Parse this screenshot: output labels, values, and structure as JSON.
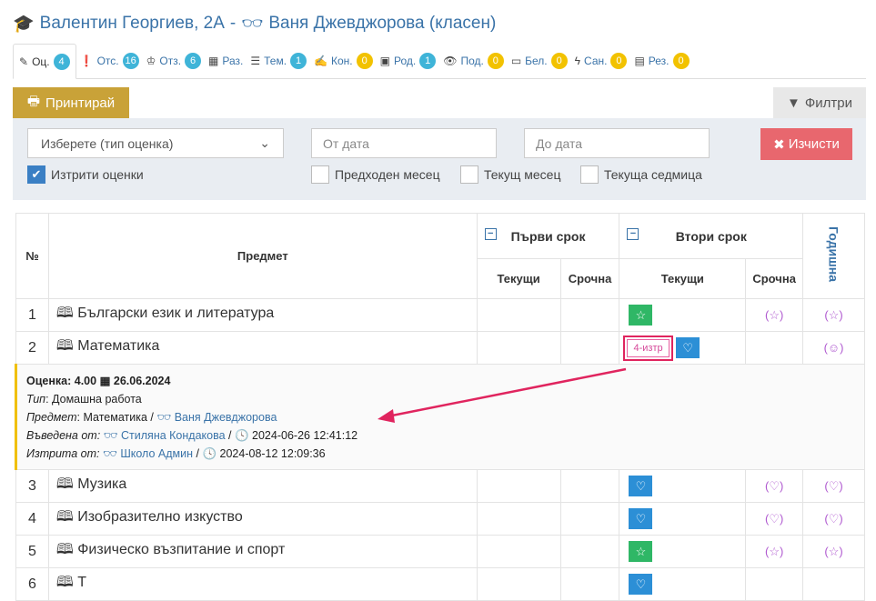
{
  "header": {
    "student": "Валентин Георгиев, 2А",
    "teacher": "Ваня Джевджорова (класен)"
  },
  "tabs": [
    {
      "label": "Оц.",
      "count": "4"
    },
    {
      "label": "Отс.",
      "count": "16"
    },
    {
      "label": "Отз.",
      "count": "6"
    },
    {
      "label": "Раз.",
      "count": ""
    },
    {
      "label": "Тем.",
      "count": "1"
    },
    {
      "label": "Кон.",
      "count": "0"
    },
    {
      "label": "Род.",
      "count": "1"
    },
    {
      "label": "Под.",
      "count": "0"
    },
    {
      "label": "Бел.",
      "count": "0"
    },
    {
      "label": "Сан.",
      "count": "0"
    },
    {
      "label": "Рез.",
      "count": "0"
    }
  ],
  "toolbar": {
    "print_label": "Принтирай",
    "filters_label": "Филтри"
  },
  "filters": {
    "grade_type_placeholder": "Изберете (тип оценка)",
    "from_date_placeholder": "От дата",
    "to_date_placeholder": "До дата",
    "clear_label": "Изчисти",
    "deleted_label": "Изтрити оценки",
    "prev_month_label": "Предходен месец",
    "curr_month_label": "Текущ месец",
    "curr_week_label": "Текуща седмица"
  },
  "table": {
    "col_no": "№",
    "col_subject": "Предмет",
    "term1": "Първи срок",
    "term2": "Втори срок",
    "annual": "Годишна",
    "current": "Текущи",
    "term_grade": "Срочна",
    "rows": [
      {
        "no": "1",
        "subject": "Български език и литература"
      },
      {
        "no": "2",
        "subject": "Математика"
      },
      {
        "no": "3",
        "subject": "Музика"
      },
      {
        "no": "4",
        "subject": "Изобразително изкуство"
      },
      {
        "no": "5",
        "subject": "Физическо възпитание и спорт"
      },
      {
        "no": "6",
        "subject": "Т"
      }
    ],
    "deleted_grade": "4-изтр"
  },
  "detail": {
    "grade_label": "Оценка: 4.00",
    "date": "26.06.2024",
    "type_label": "Тип",
    "type_value": ": Домашна работа",
    "subject_label": "Предмет",
    "subject_value": ": Математика /",
    "subject_teacher": "Ваня Джевджорова",
    "entered_label": "Въведена от:",
    "entered_by": "Стиляна Кондакова",
    "entered_at": "2024-06-26 12:41:12",
    "deleted_label": "Изтрита от:",
    "deleted_by": "Школо Админ",
    "deleted_at": "2024-08-12 12:09:36"
  }
}
